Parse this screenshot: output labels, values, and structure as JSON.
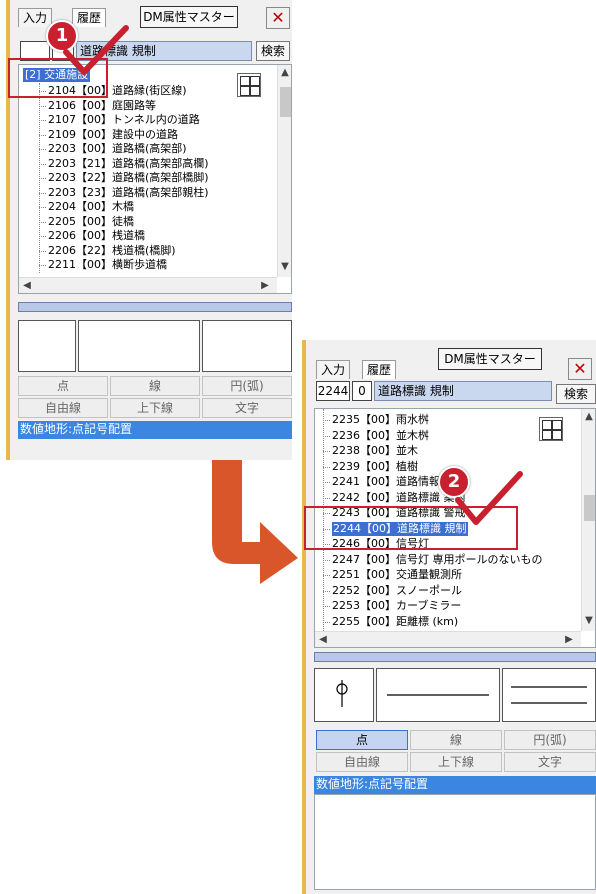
{
  "panel1": {
    "tabs": {
      "input": "入力",
      "history": "履歴"
    },
    "master_button": "DM属性マスター",
    "close": "✕",
    "code": "",
    "code_sub": "",
    "name": "道路標識 規制",
    "search": "検索",
    "tree_root": "[2] 交通施設",
    "tree_items": [
      "2104【00】道路縁(街区線)",
      "2106【00】庭園路等",
      "2107【00】トンネル内の道路",
      "2109【00】建設中の道路",
      "2203【00】道路橋(高架部)",
      "2203【21】道路橋(高架部高欄)",
      "2203【22】道路橋(高架部橋脚)",
      "2203【23】道路橋(高架部親柱)",
      "2204【00】木橋",
      "2205【00】徒橋",
      "2206【00】桟道橋",
      "2206【22】桟道橋(橋脚)",
      "2211【00】横断歩道橋"
    ],
    "buttons_row1": [
      "点",
      "線",
      "円(弧)"
    ],
    "buttons_row2": [
      "自由線",
      "上下線",
      "文字"
    ],
    "status": "数値地形:点記号配置"
  },
  "panel2": {
    "tabs": {
      "input": "入力",
      "history": "履歴"
    },
    "master_button": "DM属性マスター",
    "close": "✕",
    "code": "2244",
    "code_sub": "0",
    "name": "道路標識 規制",
    "search": "検索",
    "tree_items": [
      "2235【00】雨水桝",
      "2236【00】並木桝",
      "2238【00】並木",
      "2239【00】植樹",
      "2241【00】道路情報板",
      "2242【00】道路標識 案内",
      "2243【00】道路標識 警戒",
      "2244【00】道路標識 規制",
      "2246【00】信号灯",
      "2247【00】信号灯 専用ポールのないもの",
      "2251【00】交通量観測所",
      "2252【00】スノーポール",
      "2253【00】カーブミラー",
      "2255【00】距離標 (km)"
    ],
    "selected_index": 7,
    "buttons_row1": [
      "点",
      "線",
      "円(弧)"
    ],
    "buttons_row2": [
      "自由線",
      "上下線",
      "文字"
    ],
    "active_button": "点",
    "status": "数値地形:点記号配置"
  },
  "annotations": {
    "step1": "1",
    "step2": "2"
  },
  "colors": {
    "accent_red": "#c8202e",
    "arrow_orange": "#d9562b",
    "highlight_blue": "#3b6fd1",
    "status_blue": "#3b86e0"
  },
  "icons": [
    "grid-icon",
    "close-icon",
    "checkmark-icon",
    "arrow-icon",
    "pin-symbol-icon"
  ]
}
